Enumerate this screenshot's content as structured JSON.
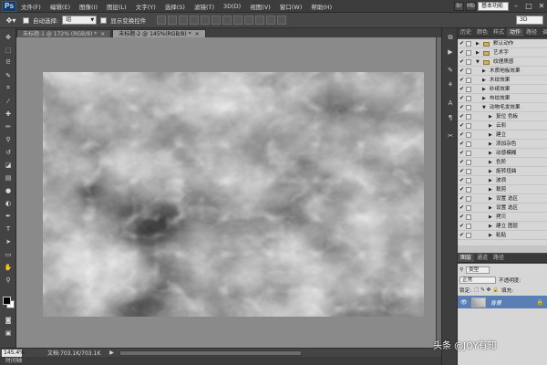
{
  "menubar": {
    "logo": "Ps",
    "items": [
      "文件(F)",
      "编辑(E)",
      "图像(I)",
      "图层(L)",
      "文字(Y)",
      "选择(S)",
      "滤镜(T)",
      "3D(D)",
      "视图(V)",
      "窗口(W)",
      "帮助(H)"
    ],
    "mode": "基本功能"
  },
  "options": {
    "auto_select_label": "自动选择:",
    "auto_select_value": "组",
    "show_transform_label": "显示变换控件",
    "workspace": "3D"
  },
  "tabs": [
    {
      "label": "未标题-1 @ 172% (RGB/8) *",
      "active": false
    },
    {
      "label": "未标题-2 @ 145%(RGB/8) *",
      "active": true
    }
  ],
  "status": {
    "zoom": "145.4%",
    "doc_info": "文档:703.1K/703.1K",
    "timeline": "时间轴"
  },
  "panel_tabs": [
    "历史",
    "颜色",
    "样式",
    "动作",
    "路径",
    "调整"
  ],
  "actions": [
    {
      "label": "默认动作",
      "indent": 0,
      "folder": true,
      "expanded": false
    },
    {
      "label": "艺术字",
      "indent": 0,
      "folder": true,
      "expanded": false
    },
    {
      "label": "纹理质感",
      "indent": 0,
      "folder": true,
      "expanded": true
    },
    {
      "label": "木质地板效果",
      "indent": 1,
      "folder": false,
      "expanded": false
    },
    {
      "label": "木纹效果",
      "indent": 1,
      "folder": false,
      "expanded": false
    },
    {
      "label": "砂纸效果",
      "indent": 1,
      "folder": false,
      "expanded": false
    },
    {
      "label": "布纹效果",
      "indent": 1,
      "folder": false,
      "expanded": false
    },
    {
      "label": "动物毛发效果",
      "indent": 1,
      "folder": false,
      "expanded": true
    },
    {
      "label": "复位 色板",
      "indent": 2,
      "folder": false,
      "expanded": false
    },
    {
      "label": "云彩",
      "indent": 2,
      "folder": false,
      "expanded": false
    },
    {
      "label": "建立",
      "indent": 2,
      "folder": false,
      "expanded": false
    },
    {
      "label": "添加杂色",
      "indent": 2,
      "folder": false,
      "expanded": false
    },
    {
      "label": "动感模糊",
      "indent": 2,
      "folder": false,
      "expanded": false
    },
    {
      "label": "色阶",
      "indent": 2,
      "folder": false,
      "expanded": false
    },
    {
      "label": "旋转扭曲",
      "indent": 2,
      "folder": false,
      "expanded": false
    },
    {
      "label": "波浪",
      "indent": 2,
      "folder": false,
      "expanded": false
    },
    {
      "label": "裁剪",
      "indent": 2,
      "folder": false,
      "expanded": false
    },
    {
      "label": "设置 选区",
      "indent": 2,
      "folder": false,
      "expanded": false
    },
    {
      "label": "设置 选区",
      "indent": 2,
      "folder": false,
      "expanded": false
    },
    {
      "label": "拷贝",
      "indent": 2,
      "folder": false,
      "expanded": false
    },
    {
      "label": "建立 图层",
      "indent": 2,
      "folder": false,
      "expanded": false
    },
    {
      "label": "粘贴",
      "indent": 2,
      "folder": false,
      "expanded": false
    }
  ],
  "layers": {
    "tabs": [
      "图层",
      "通道",
      "路径"
    ],
    "kind_label": "类型",
    "blend_mode": "正常",
    "opacity_label": "不透明度:",
    "lock_label": "锁定:",
    "fill_label": "填充:",
    "items": [
      {
        "name": "背景",
        "visible": true,
        "locked": true
      }
    ]
  },
  "watermark": "头条 @JOY有知"
}
